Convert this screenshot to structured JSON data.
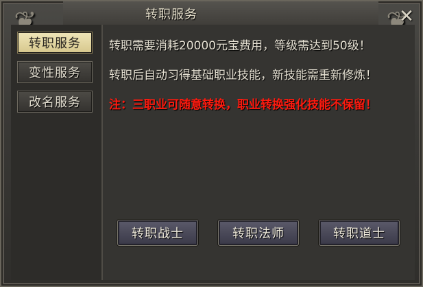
{
  "window": {
    "title": "转职服务",
    "close_symbol": "✕"
  },
  "sidebar": {
    "items": [
      {
        "label": "转职服务",
        "active": true
      },
      {
        "label": "变性服务",
        "active": false
      },
      {
        "label": "改名服务",
        "active": false
      }
    ]
  },
  "content": {
    "lines": [
      "转职需要消耗20000元宝费用，等级需达到50级！",
      "转职后自动习得基础职业技能，新技能需重新修炼！",
      "注：三职业可随意转换，职业转换强化技能不保留！"
    ],
    "warning_color": "#ff1a0f"
  },
  "actions": {
    "warrior_label": "转职战士",
    "mage_label": "转职法师",
    "taoist_label": "转职道士"
  }
}
